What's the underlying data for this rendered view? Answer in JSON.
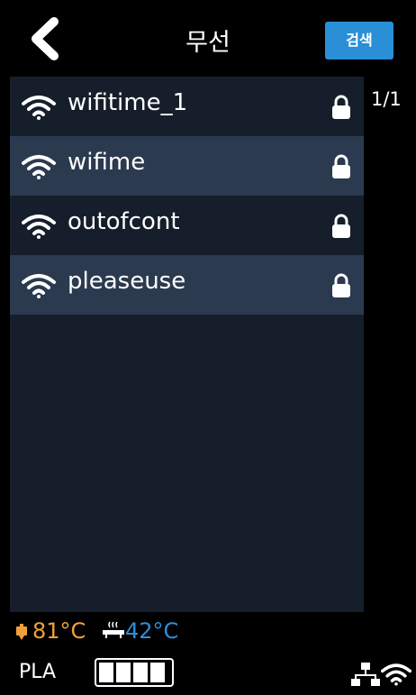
{
  "header": {
    "title": "무선",
    "search_label": "검색",
    "back_icon": "chevron-left-icon"
  },
  "networks": [
    {
      "ssid": "wifitime_1",
      "locked": true
    },
    {
      "ssid": "wifime",
      "locked": true
    },
    {
      "ssid": "outofcont",
      "locked": true
    },
    {
      "ssid": "pleaseuse",
      "locked": true
    }
  ],
  "pager": "1/1",
  "status": {
    "nozzle_temp": "81°C",
    "bed_temp": "42°C",
    "material": "PLA",
    "filament_level_segments": 4,
    "nozzle_color": "#f0a23a",
    "bed_color": "#2d8fd8"
  },
  "colors": {
    "accent": "#2a8fd6",
    "row_alt": "#2b3a4f",
    "panel": "#161e2b"
  }
}
